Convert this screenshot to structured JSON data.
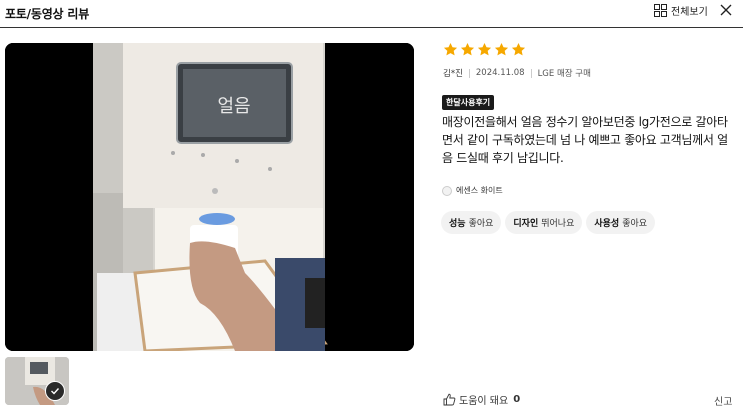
{
  "header": {
    "title": "포토/동영상 리뷰",
    "view_all_label": "전체보기"
  },
  "review": {
    "rating": 5,
    "rating_max": 5,
    "author": "김*진",
    "date": "2024.11.08",
    "purchase_channel": "LGE 매장 구매",
    "badge": "한달사용후기",
    "text": "매장이전을해서 얼음 정수기 알아보던중 lg가전으로 갈아타면서 같이 구독하였는데 넘 나 예쁘고 좋아요 고객님께서 얼음 드실때 후기 남깁니다.",
    "option": "에센스 화이트",
    "tags": [
      {
        "key": "성능",
        "value": "좋아요"
      },
      {
        "key": "디자인",
        "value": "뛰어나요"
      },
      {
        "key": "사용성",
        "value": "좋아요"
      }
    ],
    "helpful_label": "도움이 돼요",
    "helpful_count": "0",
    "report_label": "신고"
  },
  "media": {
    "display_text": "얼음"
  },
  "colors": {
    "star": "#f6a800",
    "badge_bg": "#1a1a1a",
    "tag_bg": "#f2f2f2"
  },
  "icons": {
    "view_all": "grid-icon",
    "close": "close-icon",
    "helpful": "thumbs-up-icon",
    "thumb_selected": "check-icon"
  }
}
